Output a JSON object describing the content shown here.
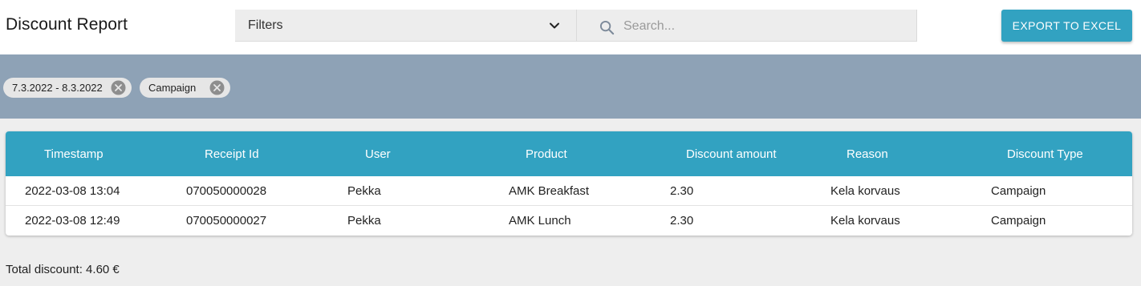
{
  "header": {
    "title": "Discount Report",
    "filters_label": "Filters",
    "search_placeholder": "Search...",
    "export_label": "EXPORT TO EXCEL"
  },
  "chips": [
    {
      "label": "7.3.2022 - 8.3.2022"
    },
    {
      "label": "Campaign"
    }
  ],
  "table": {
    "columns": [
      "Timestamp",
      "Receipt Id",
      "User",
      "Product",
      "Discount amount",
      "Reason",
      "Discount Type"
    ],
    "rows": [
      [
        "2022-03-08 13:04",
        "070050000028",
        "Pekka",
        "AMK Breakfast",
        "2.30",
        "Kela korvaus",
        "Campaign"
      ],
      [
        "2022-03-08 12:49",
        "070050000027",
        "Pekka",
        "AMK Lunch",
        "2.30",
        "Kela korvaus",
        "Campaign"
      ]
    ]
  },
  "footer": {
    "total_label": "Total discount: 4.60 €"
  },
  "colors": {
    "accent": "#32a2c1",
    "chip_bar": "#8ea2b6",
    "page_bg": "#eeeeee"
  },
  "icons": {
    "filters_toggle": "chevron-down-icon",
    "search": "search-icon",
    "chip_remove": "close-circle-icon"
  }
}
